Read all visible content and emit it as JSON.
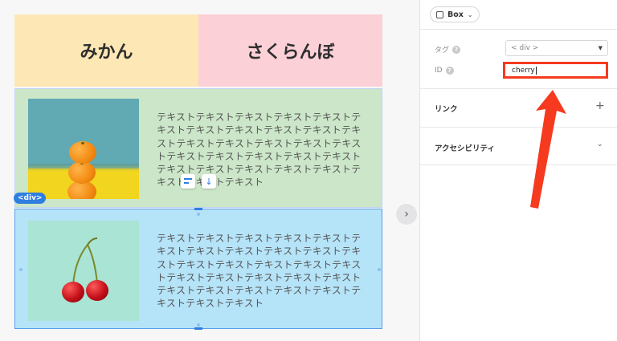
{
  "canvas": {
    "header_left": "みかん",
    "header_right": "さくらんぼ",
    "section_text": "テキストテキストテキストテキストテキストテキストテキストテキストテキストテキストテキストテキストテキストテキストテキストテキストテキストテキストテキストテキストテキストテキストテキストテキストテキストテキストテキストテキストテキスト",
    "div_tag": "<div>",
    "expand_glyph": "›"
  },
  "panel": {
    "element_type": "Box",
    "tag_label": "タグ",
    "tag_value": "< div >",
    "id_label": "ID",
    "id_value": "cherry",
    "link_label": "リンク",
    "accessibility_label": "アクセシビリティ",
    "help_glyph": "?"
  },
  "colors": {
    "header_orange": "#fde7b5",
    "header_pink": "#fcd0d7",
    "section_green": "#cbe6c8",
    "section_blue": "#b5e3f8",
    "selection_blue": "#2f7fe0",
    "annotation_red": "#f53a20"
  }
}
